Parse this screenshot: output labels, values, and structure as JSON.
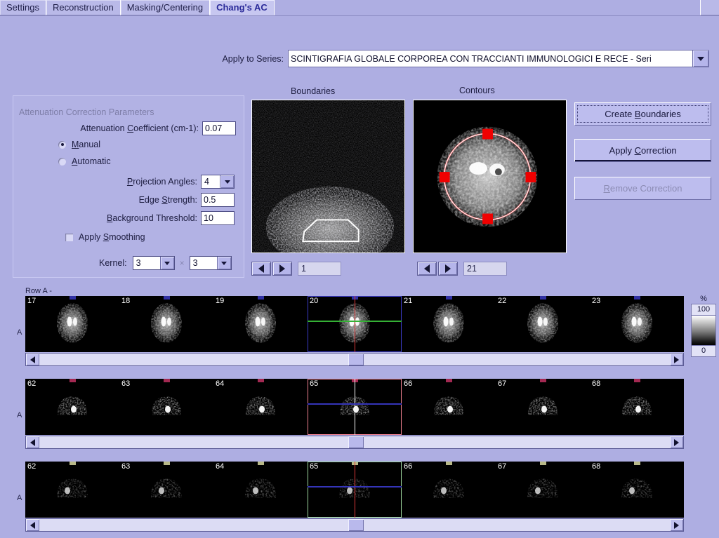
{
  "tabs": [
    {
      "label": "Settings",
      "active": false
    },
    {
      "label": "Reconstruction",
      "active": false
    },
    {
      "label": "Masking/Centering",
      "active": false
    },
    {
      "label": "Chang's AC",
      "active": true
    }
  ],
  "series": {
    "label": "Apply to Series:",
    "value": "SCINTIGRAFIA GLOBALE CORPOREA CON TRACCIANTI IMMUNOLOGICI E RECE - Seri",
    "dropdown_icon": "chevron-down-icon"
  },
  "params": {
    "group_title": "Attenuation Correction Parameters",
    "attenuation_coefficient": {
      "label_pre": "Attenuation ",
      "label_accel": "C",
      "label_post": "oefficient (cm-1):",
      "value": "0.07"
    },
    "mode": {
      "manual": {
        "label_accel": "M",
        "label_post": "anual",
        "selected": true
      },
      "automatic": {
        "label_accel": "A",
        "label_post": "utomatic",
        "selected": false
      }
    },
    "projection_angles": {
      "label_accel": "P",
      "label_post": "rojection Angles:",
      "value": "4"
    },
    "edge_strength": {
      "label_pre": "Edge ",
      "label_accel": "S",
      "label_post": "trength:",
      "value": "0.5"
    },
    "background_threshold": {
      "label_accel": "B",
      "label_post": "ackground Threshold:",
      "value": "10"
    },
    "apply_smoothing": {
      "label_pre": "Apply ",
      "label_accel": "S",
      "label_post": "moothing",
      "checked": false
    },
    "kernel": {
      "label": "Kernel:",
      "width": "3",
      "height": "3",
      "separator": "×"
    }
  },
  "panels": {
    "boundaries": {
      "caption": "Boundaries",
      "nav_value": "1",
      "prev_icon": "triangle-left-icon",
      "next_icon": "triangle-right-icon"
    },
    "contours": {
      "caption": "Contours",
      "nav_value": "21",
      "prev_icon": "triangle-left-icon",
      "next_icon": "triangle-right-icon"
    }
  },
  "actions": {
    "create_boundaries": {
      "label_pre": "Create ",
      "label_accel": "B",
      "label_post": "oundaries",
      "enabled": true,
      "focused": true
    },
    "apply_correction": {
      "label_pre": "Apply ",
      "label_accel": "C",
      "label_post": "orrection",
      "enabled": true,
      "focused": false
    },
    "remove_correction": {
      "label_pre": "",
      "label_accel": "R",
      "label_post": "emove Correction",
      "enabled": false,
      "focused": false
    }
  },
  "filmstrips": {
    "header": "Row A -",
    "rows": [
      {
        "side_label": "A",
        "slices": [
          "17",
          "18",
          "19",
          "20",
          "21",
          "22",
          "23"
        ],
        "selected_index": 3,
        "select_color": "#3c3cc8",
        "vline_color": "#e03a3a",
        "hline_color": "#35b035",
        "tick_color": "#3a3ac0",
        "blob_style": "round-bright",
        "thumb_left_pct": 49
      },
      {
        "side_label": "A",
        "slices": [
          "62",
          "63",
          "64",
          "65",
          "66",
          "67",
          "68"
        ],
        "selected_index": 3,
        "select_color": "#f08090",
        "vline_color": "#ffffff",
        "hline_color": "#3434b8",
        "tick_color": "#c03060",
        "blob_style": "dome-hot",
        "thumb_left_pct": 49
      },
      {
        "side_label": "A",
        "slices": [
          "62",
          "63",
          "64",
          "65",
          "66",
          "67",
          "68"
        ],
        "selected_index": 3,
        "select_color": "#9fd89f",
        "vline_color": "#e03a3a",
        "hline_color": "#3434b8",
        "tick_color": "#d8d8a0",
        "blob_style": "dome-soft",
        "thumb_left_pct": 49
      }
    ]
  },
  "colorbar": {
    "unit": "%",
    "max": "100",
    "min": "0"
  }
}
